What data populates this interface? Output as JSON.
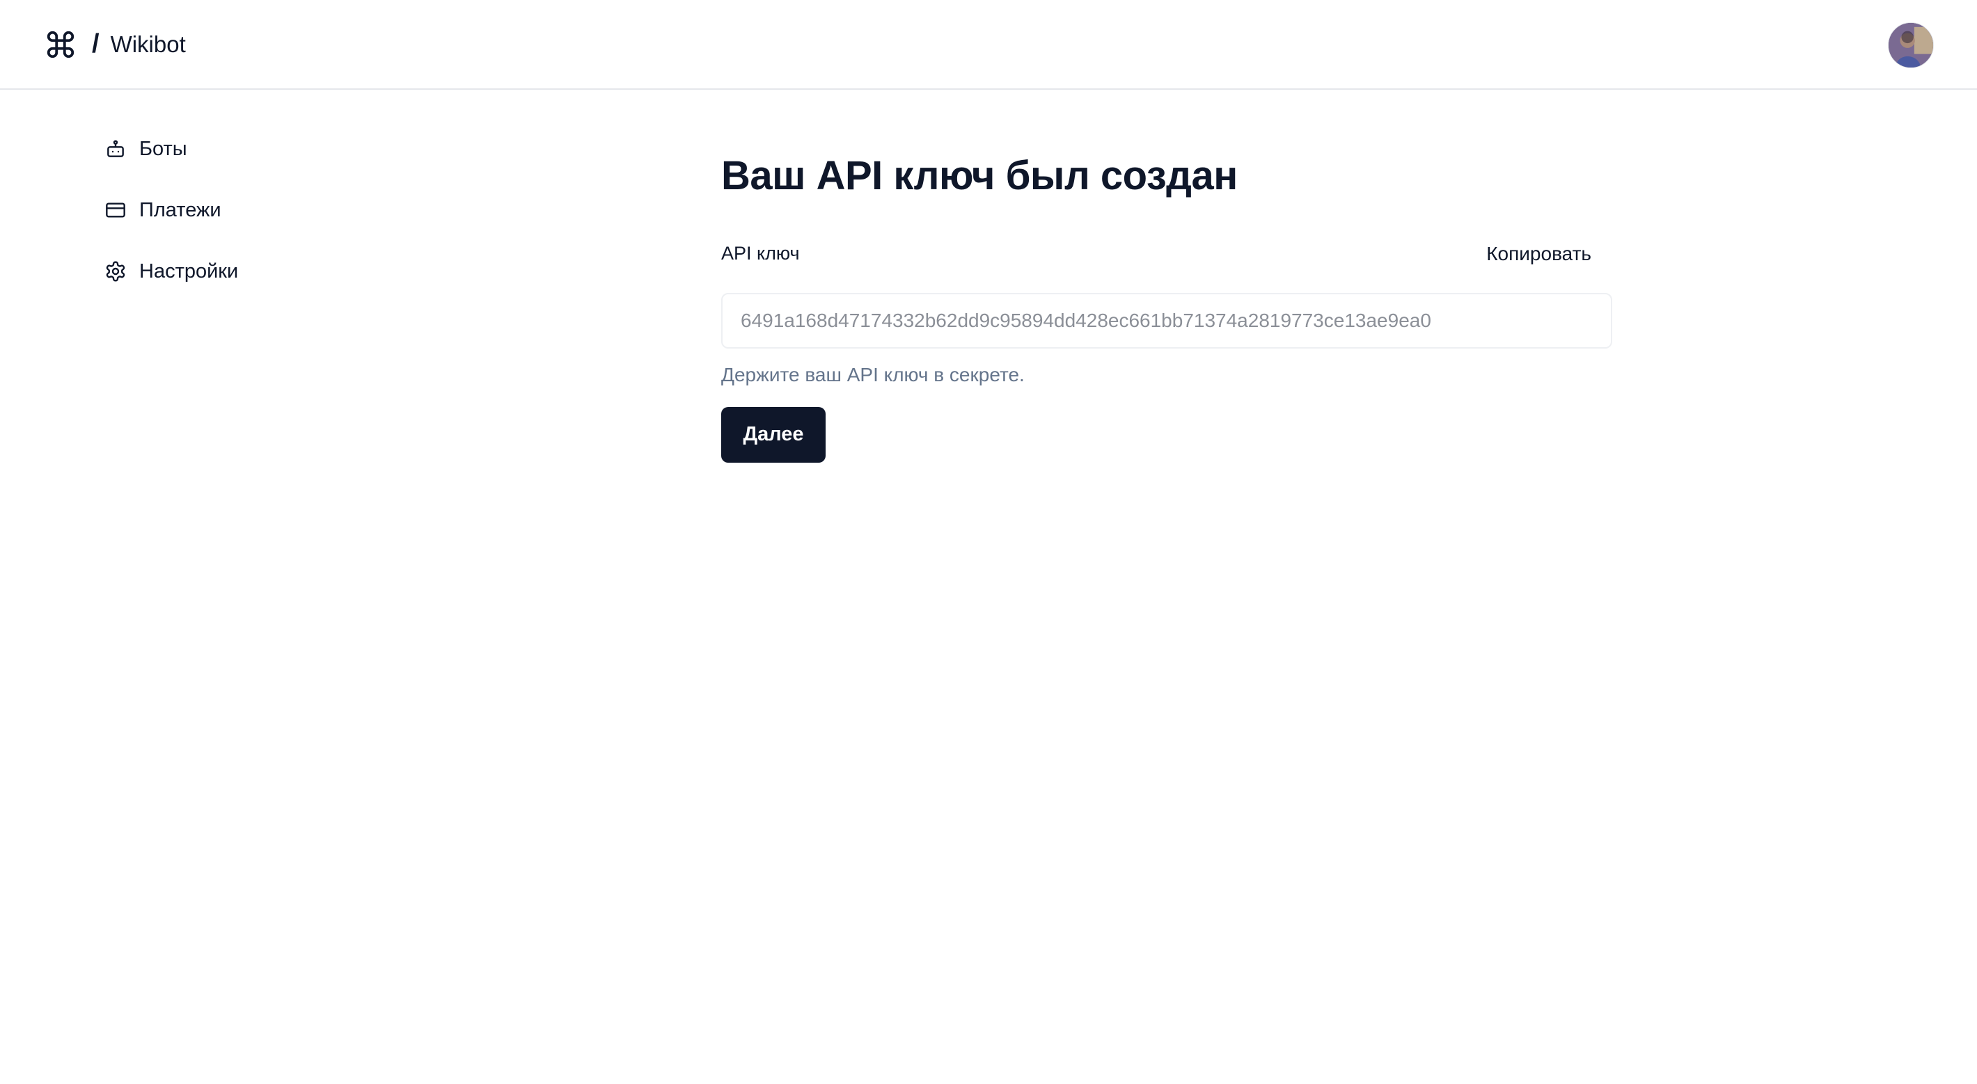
{
  "header": {
    "separator": "/",
    "app_name": "Wikibot",
    "brand_icon": "command-icon",
    "avatar": "user-avatar"
  },
  "sidebar": {
    "items": [
      {
        "label": "Боты",
        "icon": "bot-icon"
      },
      {
        "label": "Платежи",
        "icon": "credit-card-icon"
      },
      {
        "label": "Настройки",
        "icon": "gear-icon"
      }
    ]
  },
  "main": {
    "title": "Ваш API ключ был создан",
    "key_label": "API ключ",
    "copy_label": "Копировать",
    "api_key_value": "6491a168d47174332b62dd9c95894dd428ec661bb71374a2819773ce13ae9ea0",
    "hint": "Держите ваш API ключ в секрете.",
    "next_label": "Далее"
  },
  "colors": {
    "primary": "#0f172a",
    "muted_text": "#64748b",
    "input_text": "#8b8f97",
    "border": "#e5e7eb"
  }
}
